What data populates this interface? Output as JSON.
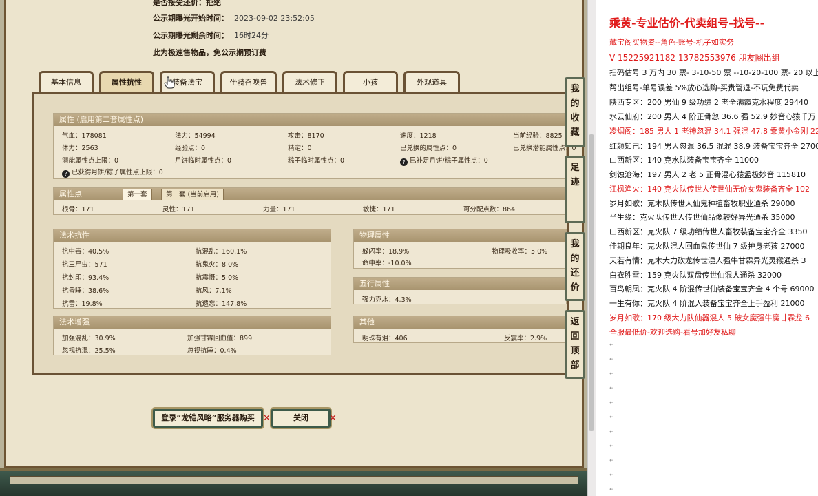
{
  "info": {
    "top_partial": "是否接受还价：拒绝",
    "start_label": "公示期曝光开始时间：",
    "start_value": "2023-09-02 23:52:05",
    "remain_label": "公示期曝光剩余时间：",
    "remain_value": "16时24分",
    "notice": "此为极速售物品，免公示期预订费"
  },
  "tabs": [
    "基本信息",
    "属性抗性",
    "装备法宝",
    "坐骑召唤兽",
    "法术修正",
    "小孩",
    "外观道具"
  ],
  "active_tab": "属性抗性",
  "attr": {
    "title": "属性 (启用第二套属性点)",
    "rows": [
      [
        "气血：178081",
        "法力：54994",
        "攻击：8170",
        "速度：1218",
        "当前经验：8825"
      ],
      [
        "体力：2563",
        "经验点：0",
        "精定：0",
        "已兑换的属性点：0",
        "已兑换潜能属性点：0"
      ],
      [
        "潜能属性点上限：0",
        "月饼临时属性点：0",
        "粽子临时属性点：0",
        "已补足月饼/粽子属性点：0",
        ""
      ],
      [
        "已获得月饼/粽子属性点上限：0"
      ]
    ]
  },
  "points": {
    "title": "属性点",
    "sub_tab1": "第一套",
    "sub_tab2": "第二套 (当前启用)",
    "values": [
      "根骨：171",
      "灵性：171",
      "力量：171",
      "敏捷：171",
      "可分配点数：864"
    ]
  },
  "fashu_kang": {
    "title": "法术抗性",
    "rows": [
      [
        "抗中毒：40.5%",
        "抗混乱：160.1%"
      ],
      [
        "抗三尸虫：571",
        "抗鬼火：8.0%"
      ],
      [
        "抗封印：93.4%",
        "抗震慑：5.0%"
      ],
      [
        "抗昏睡：38.6%",
        "抗风：7.1%"
      ],
      [
        "抗雷：19.8%",
        "抗遗忘：147.8%"
      ]
    ]
  },
  "wuli": {
    "title": "物理属性",
    "rows": [
      [
        "躲闪率：18.9%",
        "物理吸收率：5.0%"
      ],
      [
        "命中率：-10.0%",
        ""
      ]
    ]
  },
  "wuxing": {
    "title": "五行属性",
    "value": "强力克水：4.3%"
  },
  "fashu_zeng": {
    "title": "法术增强",
    "rows": [
      [
        "加强混乱：30.9%",
        "加强甘霖回血值：899"
      ],
      [
        "忽视抗混：25.5%",
        "忽视抗睡：0.4%"
      ]
    ]
  },
  "other": {
    "title": "其他",
    "values": [
      "明珠有泪：406",
      "反震率：2.9%"
    ]
  },
  "buttons": {
    "buy": "登录“龙铠风略”服务器购买",
    "close": "关闭"
  },
  "side": [
    "我的收藏",
    "足迹",
    "我的还价",
    "返回顶部"
  ],
  "right": {
    "title": "乘黄-专业估价-代卖组号-找号--",
    "lines": [
      {
        "t": "藏宝阁买物资--角色-账号-机子如实务",
        "red": true
      },
      {
        "t": "V 15225921182      13782553976 朋友圈出组",
        "red": true
      },
      {
        "t": "扫码估号 3 万内 30 票- 3-10-50 票  --10-20-100 票- 20 以上 1",
        "red": false
      },
      {
        "t": "帮出组号-单号误差 5%放心选购-买贵管退-不玩免费代卖",
        "red": false
      },
      {
        "t": "陕西专区：200 男仙 9 级功绩 2 老全满霞克水程度 29440",
        "red": false
      },
      {
        "t": "水云仙府：200 男人 4 阶正骨忽 36.6 强 52.9 妙音心猿千万",
        "red": false
      },
      {
        "t": "凌烟阁：185 男人 1 老神忽混 34.1 强混 47.8 乘黄小金刚 22",
        "red": true
      },
      {
        "t": "红颜知己：194 男人忽混 36.5 混混 38.9 装备宝宝齐全 2700",
        "red": false
      },
      {
        "t": "山西新区：140 克水队装备宝宝齐全 11000",
        "red": false
      },
      {
        "t": "剑蚀沧海：197 男人 2 老 5 正骨混心猿孟极妙音 115810",
        "red": false
      },
      {
        "t": "江枫渔火：140 克火队传世人传世仙无价女鬼装备齐全 102",
        "red": true
      },
      {
        "t": "岁月如歌：克木队传世人仙鬼种植畜牧职业通杀 29000",
        "red": false
      },
      {
        "t": "半生缘：克火队传世人传世仙品像较好异光通杀 35000",
        "red": false
      },
      {
        "t": "山西新区：克火队 7 级功绩传世人畜牧装备宝宝齐全 3350",
        "red": false
      },
      {
        "t": "佳期良年：克火队混人回血鬼传世仙 7 级护身老孩 27000",
        "red": false
      },
      {
        "t": "天若有情：克木大力砍龙传世混人强牛甘霖异光灵猴通杀 3",
        "red": false
      },
      {
        "t": "白衣胜雪：159 克火队双盘传世仙混人通杀 32000",
        "red": false
      },
      {
        "t": "百鸟朝凤：克火队 4 阶混传世仙装备宝宝齐全 4 个号 69000",
        "red": false
      },
      {
        "t": "一生有你：克火队 4 阶混人装备宝宝齐全上手盈利 21000",
        "red": false
      },
      {
        "t": "岁月如歌：170 级大力队仙器混人 5 破女魔强牛魔甘霖龙 6",
        "red": true
      },
      {
        "t": "全服最低价-欢迎选购-看号加好友私聊",
        "red": true
      }
    ]
  }
}
